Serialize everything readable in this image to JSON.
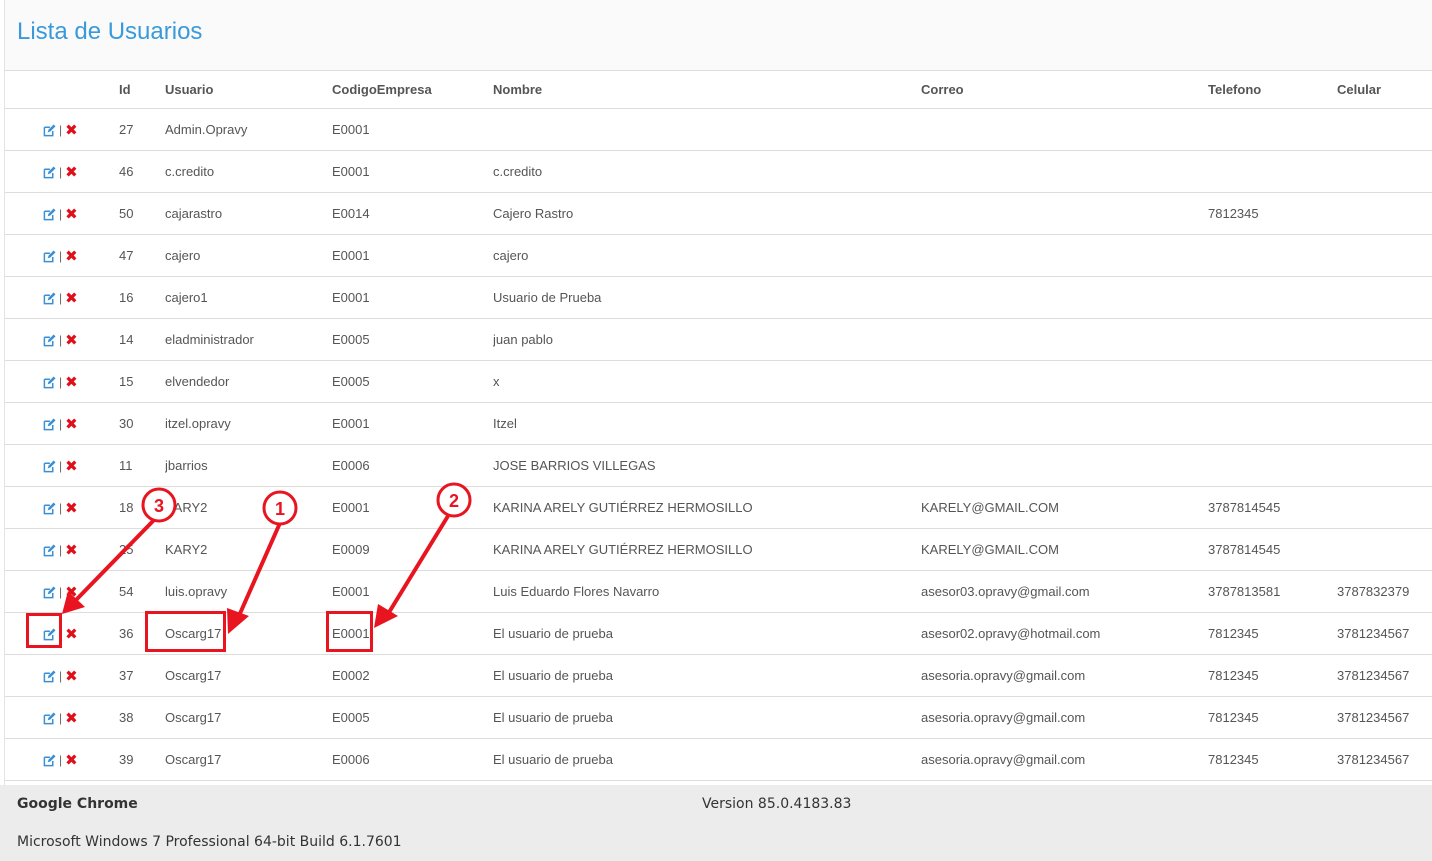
{
  "page": {
    "title": "Lista de Usuarios"
  },
  "table": {
    "headers": [
      "Id",
      "Usuario",
      "CodigoEmpresa",
      "Nombre",
      "Correo",
      "Telefono",
      "Celular"
    ],
    "action_separator": "|",
    "rows": [
      {
        "id": "27",
        "usuario": "Admin.Opravy",
        "codigo": "E0001",
        "nombre": "",
        "correo": "",
        "telefono": "",
        "celular": ""
      },
      {
        "id": "46",
        "usuario": "c.credito",
        "codigo": "E0001",
        "nombre": "c.credito",
        "correo": "",
        "telefono": "",
        "celular": ""
      },
      {
        "id": "50",
        "usuario": "cajarastro",
        "codigo": "E0014",
        "nombre": "Cajero Rastro",
        "correo": "",
        "telefono": "7812345",
        "celular": ""
      },
      {
        "id": "47",
        "usuario": "cajero",
        "codigo": "E0001",
        "nombre": "cajero",
        "correo": "",
        "telefono": "",
        "celular": ""
      },
      {
        "id": "16",
        "usuario": "cajero1",
        "codigo": "E0001",
        "nombre": "Usuario de Prueba",
        "correo": "",
        "telefono": "",
        "celular": ""
      },
      {
        "id": "14",
        "usuario": "eladministrador",
        "codigo": "E0005",
        "nombre": "juan pablo",
        "correo": "",
        "telefono": "",
        "celular": ""
      },
      {
        "id": "15",
        "usuario": "elvendedor",
        "codigo": "E0005",
        "nombre": "x",
        "correo": "",
        "telefono": "",
        "celular": ""
      },
      {
        "id": "30",
        "usuario": "itzel.opravy",
        "codigo": "E0001",
        "nombre": "Itzel",
        "correo": "",
        "telefono": "",
        "celular": ""
      },
      {
        "id": "11",
        "usuario": "jbarrios",
        "codigo": "E0006",
        "nombre": "JOSE BARRIOS VILLEGAS",
        "correo": "",
        "telefono": "",
        "celular": ""
      },
      {
        "id": "18",
        "usuario": "KARY2",
        "codigo": "E0001",
        "nombre": "KARINA ARELY GUTIÉRREZ HERMOSILLO",
        "correo": "KARELY@GMAIL.COM",
        "telefono": "3787814545",
        "celular": ""
      },
      {
        "id": "25",
        "usuario": "KARY2",
        "codigo": "E0009",
        "nombre": "KARINA ARELY GUTIÉRREZ HERMOSILLO",
        "correo": "KARELY@GMAIL.COM",
        "telefono": "3787814545",
        "celular": ""
      },
      {
        "id": "54",
        "usuario": "luis.opravy",
        "codigo": "E0001",
        "nombre": "Luis Eduardo Flores Navarro",
        "correo": "asesor03.opravy@gmail.com",
        "telefono": "3787813581",
        "celular": "3787832379"
      },
      {
        "id": "36",
        "usuario": "Oscarg17",
        "codigo": "E0001",
        "nombre": "El usuario de prueba",
        "correo": "asesor02.opravy@hotmail.com",
        "telefono": "7812345",
        "celular": "3781234567"
      },
      {
        "id": "37",
        "usuario": "Oscarg17",
        "codigo": "E0002",
        "nombre": "El usuario de prueba",
        "correo": "asesoria.opravy@gmail.com",
        "telefono": "7812345",
        "celular": "3781234567"
      },
      {
        "id": "38",
        "usuario": "Oscarg17",
        "codigo": "E0005",
        "nombre": "El usuario de prueba",
        "correo": "asesoria.opravy@gmail.com",
        "telefono": "7812345",
        "celular": "3781234567"
      },
      {
        "id": "39",
        "usuario": "Oscarg17",
        "codigo": "E0006",
        "nombre": "El usuario de prueba",
        "correo": "asesoria.opravy@gmail.com",
        "telefono": "7812345",
        "celular": "3781234567"
      }
    ]
  },
  "footer": {
    "browser": "Google Chrome",
    "version": "Version 85.0.4183.83",
    "os": "Microsoft Windows 7 Professional  64-bit Build 6.1.7601"
  },
  "annotations": {
    "color": "#e8141f",
    "markers": [
      "1",
      "2",
      "3"
    ]
  },
  "colors": {
    "title": "#3a9ad9",
    "edit_icon": "#3a8fd6",
    "delete_icon": "#e0101a"
  },
  "icons": {
    "edit": "edit-icon",
    "delete": "delete-icon"
  }
}
